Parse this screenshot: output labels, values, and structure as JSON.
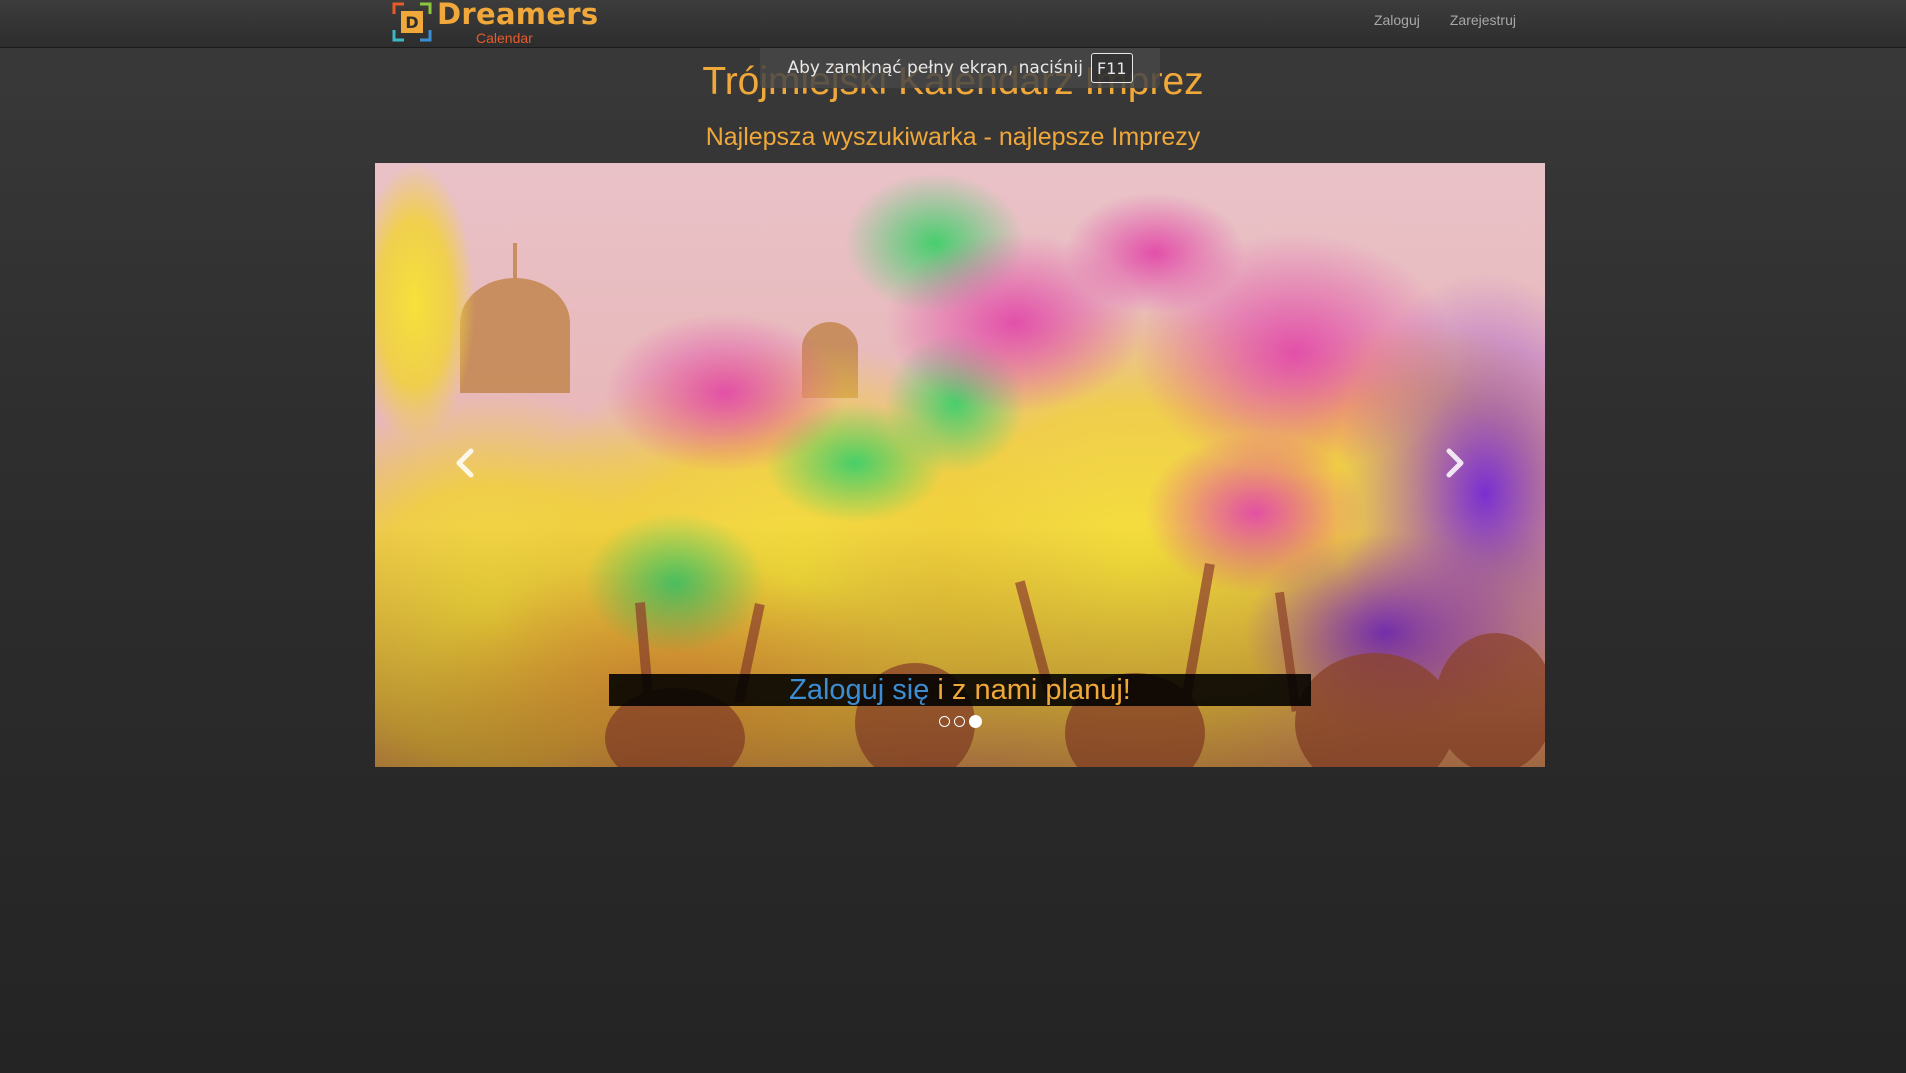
{
  "brand": {
    "name": "Dreamers",
    "sub": "Calendar",
    "mark_letter": "D"
  },
  "nav": {
    "login": "Zaloguj",
    "register": "Zarejestruj"
  },
  "fullscreen_notice": {
    "text": "Aby zamknąć pełny ekran, naciśnij",
    "key": "F11"
  },
  "page": {
    "title": "Trójmiejski Kalendarz Imprez",
    "subtitle": "Najlepsza wyszukiwarka - najlepsze Imprezy"
  },
  "carousel": {
    "caption_link": "Zaloguj się",
    "caption_rest": " i z nami planuj!",
    "slide_count": 3,
    "active_slide": 3
  },
  "colors": {
    "accent": "#f0a83a",
    "link": "#3b8ed4",
    "brand_sub": "#e85a2a",
    "nav_text": "#a8a8a8"
  }
}
